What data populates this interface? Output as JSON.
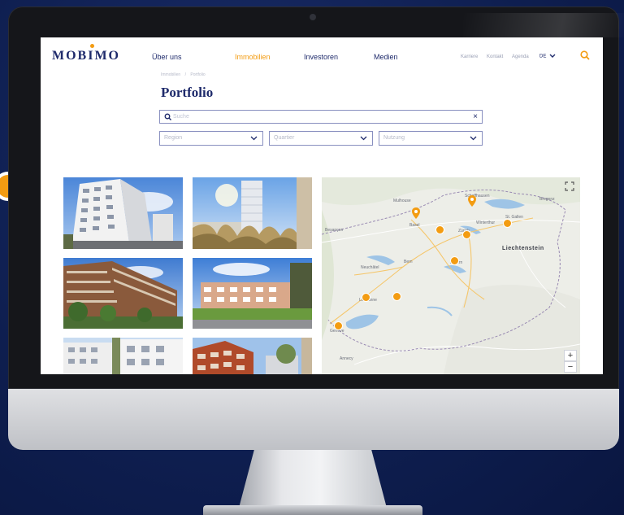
{
  "brand": {
    "logo_text": "MOBIMO",
    "accent": "#f39c12",
    "primary": "#1e2a6b",
    "background": "#0e1e4f"
  },
  "nav": [
    {
      "label": "Über uns",
      "active": false
    },
    {
      "label": "Immobilien",
      "active": true
    },
    {
      "label": "Investoren",
      "active": false
    },
    {
      "label": "Medien",
      "active": false
    }
  ],
  "utility_nav": [
    "Karriere",
    "Kontakt",
    "Agenda"
  ],
  "language": {
    "current": "DE",
    "icon": "chevron-down-icon"
  },
  "header_icons": {
    "search": "search-icon"
  },
  "breadcrumb": {
    "items": [
      "Immobilien",
      "Portfolio"
    ],
    "separator": "/"
  },
  "page": {
    "title": "Portfolio"
  },
  "search": {
    "placeholder": "Suche",
    "icon": "search-icon",
    "clear_icon": "close-icon",
    "clear_glyph": "×"
  },
  "filters": [
    {
      "label": "Region",
      "icon": "chevron-down-icon"
    },
    {
      "label": "Quartier",
      "icon": "chevron-down-icon"
    },
    {
      "label": "Nutzung",
      "icon": "chevron-down-icon"
    }
  ],
  "photos": [
    "property-photo-1",
    "property-photo-2",
    "property-photo-3",
    "property-photo-4",
    "property-photo-5",
    "property-photo-6"
  ],
  "map": {
    "region_label": "Liechtenstein",
    "city_labels": [
      "Mulhouse",
      "Basel",
      "Zürich",
      "Bern",
      "Schaffhausen",
      "Winterthur",
      "Besançon",
      "Neuchâtel",
      "Lausanne",
      "Genève",
      "Annecy",
      "Luzern",
      "Bregenz",
      "St. Gallen"
    ],
    "marker_count": 9,
    "controls": {
      "zoom_in": "+",
      "zoom_out": "−",
      "fullscreen_icon": "fullscreen-icon"
    }
  }
}
